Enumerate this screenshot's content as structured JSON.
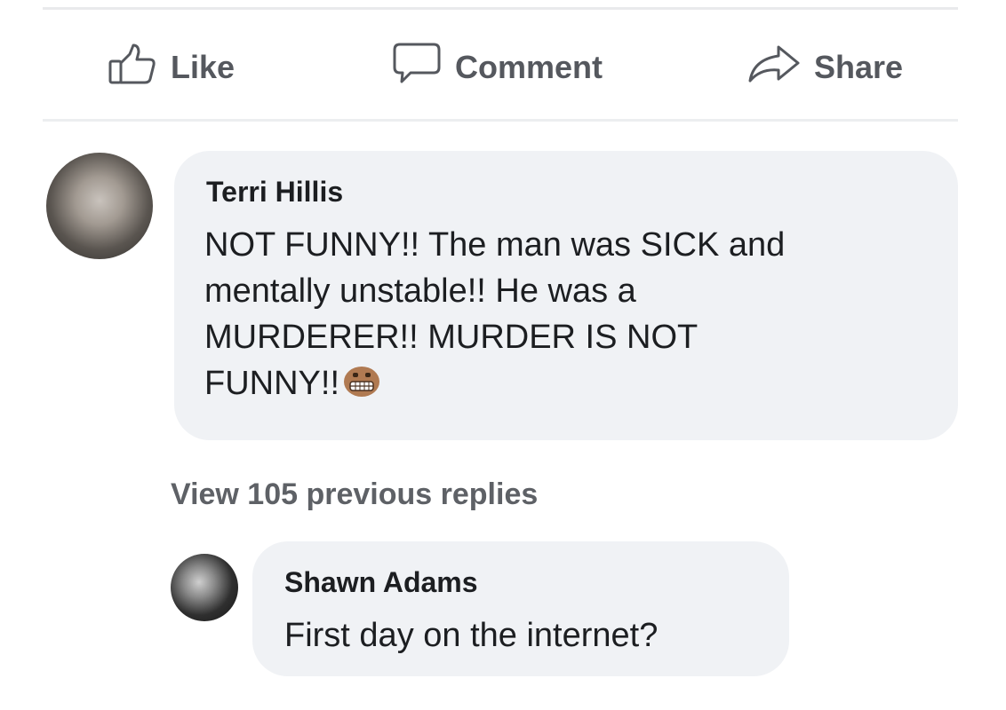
{
  "actions": {
    "like_label": "Like",
    "comment_label": "Comment",
    "share_label": "Share",
    "like_icon": "thumbs-up-icon",
    "comment_icon": "speech-bubble-icon",
    "share_icon": "share-arrow-icon"
  },
  "comments": [
    {
      "author": "Terri Hillis",
      "lines": [
        "NOT FUNNY!! The man was SICK and",
        "mentally unstable!! He was a",
        "MURDERER!! MURDER IS NOT",
        "FUNNY!!"
      ],
      "emoji": "grimacing-face-icon"
    }
  ],
  "view_replies_label": "View 105 previous replies",
  "reply": {
    "author": "Shawn Adams",
    "text": "First day on the internet?"
  },
  "colors": {
    "bubble_background": "#f0f2f5",
    "action_text": "#55585e",
    "body_text": "#1c1e21"
  }
}
